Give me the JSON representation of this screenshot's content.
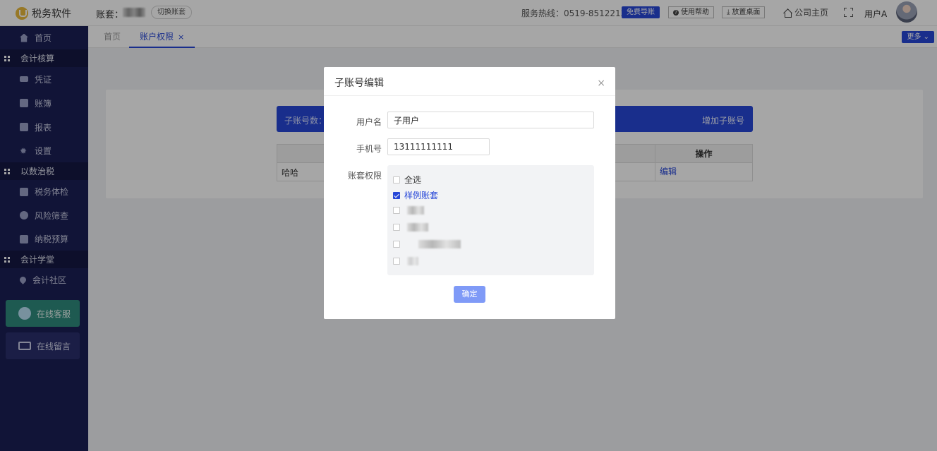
{
  "header": {
    "app_name": "税务软件",
    "account_label": "账套：",
    "switch_button": "切换账套",
    "hotline": "服务热线：0519-85122137",
    "free_import": "免费导账",
    "help": "使用帮助",
    "desktop": "放置桌面",
    "company_home": "公司主页",
    "user": "用户A"
  },
  "sidebar": {
    "home": "首页",
    "group_accounting": "会计核算",
    "voucher": "凭证",
    "ledger": "账簿",
    "report": "报表",
    "settings": "设置",
    "group_tax": "以数治税",
    "tax_check": "税务体检",
    "risk_screen": "风险筛查",
    "tax_budget": "纳税预算",
    "group_school": "会计学堂",
    "community": "会计社区",
    "online_service": "在线客服",
    "online_message": "在线留言"
  },
  "tabs": {
    "home": "首页",
    "active": "账户权限",
    "close": "×",
    "more": "更多"
  },
  "content": {
    "sub_count_label": "子账号数：",
    "add_sub": "增加子账号",
    "col_operation": "操作",
    "row_name": "哈哈",
    "row_edit": "编辑"
  },
  "modal": {
    "title": "子账号编辑",
    "close": "×",
    "username_label": "用户名",
    "username_value": "子用户",
    "phone_label": "手机号",
    "phone_value": "13111111111",
    "perm_label": "账套权限",
    "select_all": "全选",
    "sample_account": "样例账套",
    "confirm": "确定"
  },
  "colors": {
    "primary": "#2747d8",
    "sidebar": "#1b1f55",
    "confirm_button": "#7f9af7"
  }
}
